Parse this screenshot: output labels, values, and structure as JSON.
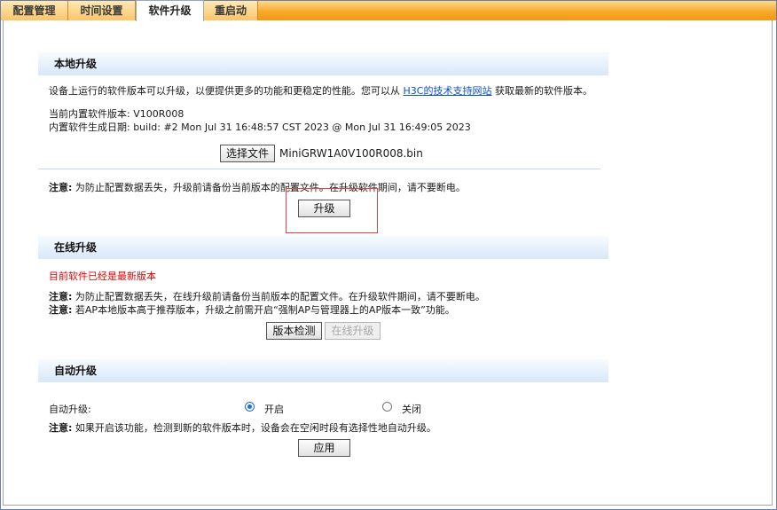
{
  "tabs": [
    {
      "label": "配置管理",
      "active": false
    },
    {
      "label": "时间设置",
      "active": false
    },
    {
      "label": "软件升级",
      "active": true
    },
    {
      "label": "重启动",
      "active": false
    }
  ],
  "local": {
    "title": "本地升级",
    "desc_prefix": "设备上运行的软件版本可以升级，以便提供更多的功能和更稳定的性能。您可以从",
    "desc_link": "H3C的技术支持网站",
    "desc_suffix": "获取最新的软件版本。",
    "version_line": "当前内置软件版本: V100R008",
    "build_line": "内置软件生成日期:  build: #2 Mon Jul 31 16:48:57 CST 2023 @ Mon Jul 31 16:49:05 2023",
    "choose_file_button": "选择文件",
    "file_name": "MiniGRW1A0V100R008.bin",
    "note_label": "注意:",
    "note_text": "为防止配置数据丢失，升级前请备份当前版本的配置文件。在升级软件期间，请不要断电。",
    "upgrade_button": "升级"
  },
  "online": {
    "title": "在线升级",
    "status": "目前软件已经是最新版本",
    "note1_label": "注意:",
    "note1_text": "为防止配置数据丢失，在线升级前请备份当前版本的配置文件。在升级软件期间，请不要断电。",
    "note2_label": "注意:",
    "note2_text": "若AP本地版本高于推荐版本，升级之前需开启“强制AP与管理器上的AP版本一致”功能。",
    "check_button": "版本检测",
    "online_upgrade_button": "在线升级"
  },
  "auto": {
    "title": "自动升级",
    "label": "自动升级:",
    "option_on": "开启",
    "option_off": "关闭",
    "selected": "开启",
    "note_label": "注意:",
    "note_text": "如果开启该功能，检测到新的软件版本时，设备会在空闲时段有选择性地自动升级。",
    "apply_button": "应用"
  },
  "colors": {
    "tab_bar": "#f6a623",
    "status_red": "#e00000",
    "link_blue": "#0b4fc9",
    "highlight_border": "#d84848"
  }
}
